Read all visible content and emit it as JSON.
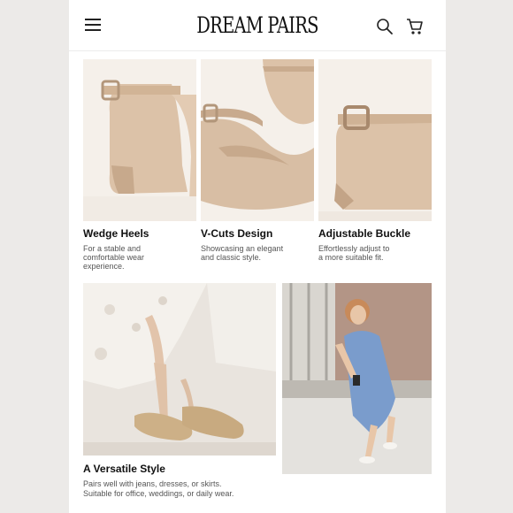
{
  "header": {
    "brand": "DREAM PAIRS",
    "menu_icon": "hamburger-menu-icon",
    "search_icon": "search-icon",
    "cart_icon": "cart-icon"
  },
  "features": [
    {
      "title": "Wedge Heels",
      "desc_line1": "For a stable and",
      "desc_line2": "comfortable wear",
      "desc_line3": "experience."
    },
    {
      "title": "V-Cuts Design",
      "desc_line1": "Showcasing an elegant",
      "desc_line2": "and classic style.",
      "desc_line3": ""
    },
    {
      "title": "Adjustable Buckle",
      "desc_line1": "Effortlessly adjust to",
      "desc_line2": "a more suitable fit.",
      "desc_line3": ""
    }
  ],
  "versatile": {
    "title": "A Versatile Style",
    "desc_line1": "Pairs well with jeans, dresses, or skirts.",
    "desc_line2": "Suitable for office, weddings, or daily wear."
  },
  "colors": {
    "nude": "#d8bea4",
    "nude_shadow": "#b99c80",
    "tile_bg": "#f4efe9",
    "denim": "#7a9ccc"
  }
}
